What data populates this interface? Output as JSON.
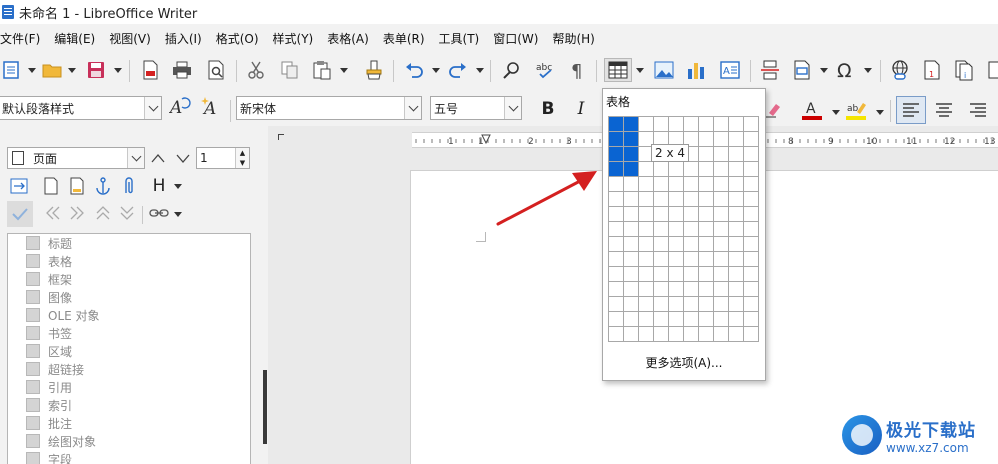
{
  "window": {
    "title": "未命名 1 - LibreOffice Writer"
  },
  "menubar": [
    "文件(F)",
    "编辑(E)",
    "视图(V)",
    "插入(I)",
    "格式(O)",
    "样式(Y)",
    "表格(A)",
    "表单(R)",
    "工具(T)",
    "窗口(W)",
    "帮助(H)"
  ],
  "toolbar_icons": [
    "new-document-icon",
    "open-folder-icon",
    "save-icon",
    "export-pdf-icon",
    "print-icon",
    "print-preview-icon",
    "cut-icon",
    "copy-icon",
    "paste-icon",
    "clone-formatting-icon",
    "undo-icon",
    "redo-icon",
    "find-replace-icon",
    "spellcheck-icon",
    "formatting-marks-icon",
    "insert-table-icon",
    "insert-image-icon",
    "insert-chart-icon",
    "insert-textbox-icon",
    "page-break-icon",
    "insert-field-icon",
    "special-character-icon",
    "hyperlink-icon",
    "footnote-icon",
    "endnote-icon"
  ],
  "format_bar": {
    "paragraph_style": "默认段落样式",
    "font_name": "新宋体",
    "font_size": "五号",
    "bold": "B",
    "italic": "I",
    "font_color": "#cc0000",
    "highlight_color": "#f5e500"
  },
  "navigator": {
    "category": "页面",
    "page_number": "1",
    "heading_button": "H",
    "items": [
      "标题",
      "表格",
      "框架",
      "图像",
      "OLE 对象",
      "书签",
      "区域",
      "超链接",
      "引用",
      "索引",
      "批注",
      "绘图对象",
      "字段"
    ]
  },
  "table_popup": {
    "title": "表格",
    "columns": 10,
    "rows": 15,
    "selected_columns": 2,
    "selected_rows": 4,
    "size_label": "2 x 4",
    "more_options": "更多选项(A)..."
  },
  "ruler": {
    "labels": [
      "1",
      "1",
      "2",
      "3",
      "8",
      "9",
      "10",
      "11",
      "12",
      "13",
      "14"
    ]
  },
  "watermark": {
    "name": "极光下载站",
    "url": "www.xz7.com",
    "accent": "#2a6fc9"
  },
  "annotation": {
    "arrow_color": "#d42020"
  }
}
